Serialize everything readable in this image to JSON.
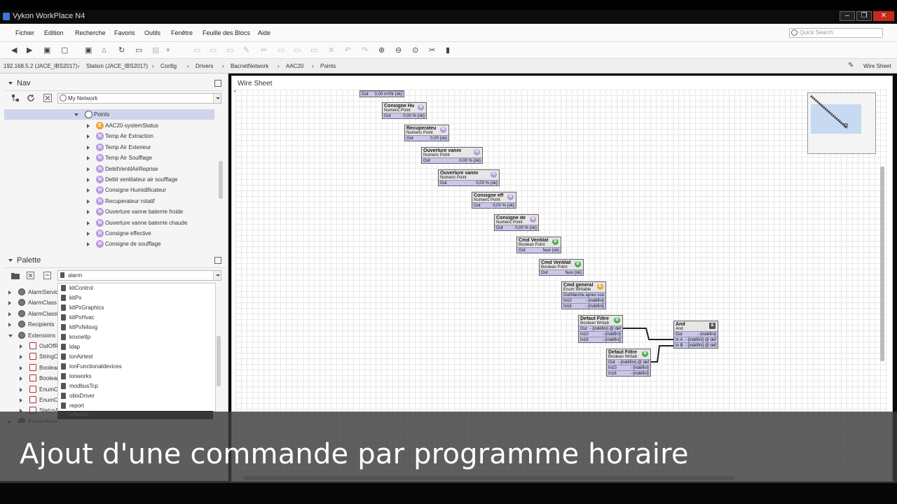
{
  "window": {
    "title": "Vykon WorkPlace N4"
  },
  "menu": [
    "Fichier",
    "Edition",
    "Recherche",
    "Favoris",
    "Outils",
    "Fenêtre",
    "Feuille des Blocs",
    "Aide"
  ],
  "search": {
    "placeholder": "Quick Search"
  },
  "breadcrumb": [
    "192.168.5.2 (JACE_IBS2017)",
    "Station (JACE_IBS2017)",
    "Config",
    "Drivers",
    "BacnetNetwork",
    "AAC20",
    "Points"
  ],
  "view_selector": "Wire Sheet",
  "nav": {
    "title": "Nav",
    "network": "My Network",
    "selected": "Points",
    "items": [
      {
        "label": "AAC20-systemStatus",
        "icon": "E"
      },
      {
        "label": "Temp Air Extraction",
        "icon": "N"
      },
      {
        "label": "Temp Air Exterieur",
        "icon": "N"
      },
      {
        "label": "Temp Air Soufflage",
        "icon": "N"
      },
      {
        "label": "DebitVentilAirReprise",
        "icon": "N"
      },
      {
        "label": "Debit ventilateur air soufflage",
        "icon": "N"
      },
      {
        "label": "Consigne Humidificateur",
        "icon": "N"
      },
      {
        "label": "Recuperateur rotatif",
        "icon": "N"
      },
      {
        "label": "Ouverture vanne baterrie froide",
        "icon": "N"
      },
      {
        "label": "Ouverture vanne baterrie chaude",
        "icon": "N"
      },
      {
        "label": "Consigne effective",
        "icon": "N"
      },
      {
        "label": "Consigne de soufflage",
        "icon": "N"
      }
    ]
  },
  "palette": {
    "title": "Palette",
    "filter": "alarm",
    "modules": [
      "kitControl",
      "kitPx",
      "kitPxGraphics",
      "kitPxHvac",
      "kitPxN4svg",
      "knxnetIp",
      "ldap",
      "lonAirtest",
      "lonFunctionaldevices",
      "lonworks",
      "modbusTcp",
      "obixDriver",
      "report"
    ],
    "drag_label": "schedule",
    "tree": [
      {
        "label": "AlarmService",
        "depth": 1,
        "exp": "r"
      },
      {
        "label": "AlarmClass",
        "depth": 1,
        "exp": "r"
      },
      {
        "label": "AlarmClassFolder",
        "depth": 1,
        "exp": "r"
      },
      {
        "label": "Recipients",
        "depth": 1,
        "exp": "r"
      },
      {
        "label": "Extensions",
        "depth": 1,
        "exp": "d"
      },
      {
        "label": "OutOfRange",
        "depth": 2,
        "exp": "r"
      },
      {
        "label": "StringChange",
        "depth": 2,
        "exp": "r"
      },
      {
        "label": "BooleanChange",
        "depth": 2,
        "exp": "r"
      },
      {
        "label": "BooleanCov",
        "depth": 2,
        "exp": "r"
      },
      {
        "label": "EnumChange",
        "depth": 2,
        "exp": "r"
      },
      {
        "label": "EnumCov",
        "depth": 2,
        "exp": "r"
      },
      {
        "label": "StatusAlarm",
        "depth": 2,
        "exp": "r"
      },
      {
        "label": "PrinterRecipient",
        "depth": 1,
        "exp": "r"
      }
    ]
  },
  "wiresheet": {
    "tab": "Wire Sheet",
    "blocks": [
      {
        "title": "",
        "type": "",
        "badge": "",
        "slots": [
          [
            "Out",
            "0,00 m³/hr {ok}"
          ]
        ]
      },
      {
        "title": "Consigne Hu",
        "type": "Numeric Point",
        "badge": "N",
        "slots": [
          [
            "Out",
            "0,00 % {ok}"
          ]
        ]
      },
      {
        "title": "Recuperateu",
        "type": "Numeric Point",
        "badge": "N",
        "slots": [
          [
            "Out",
            "0,00 {ok}"
          ]
        ]
      },
      {
        "title": "Ouverture vanne ba",
        "type": "Numeric Point",
        "badge": "N",
        "slots": [
          [
            "Out",
            "0,00 % {ok}"
          ]
        ]
      },
      {
        "title": "Ouverture vanne ba",
        "type": "Numeric Point",
        "badge": "N",
        "slots": [
          [
            "Out",
            "0,00 % {ok}"
          ]
        ]
      },
      {
        "title": "Consigne eff",
        "type": "Numeric Point",
        "badge": "N",
        "slots": [
          [
            "Out",
            "0,00 % {ok}"
          ]
        ]
      },
      {
        "title": "Consigne de",
        "type": "Numeric Point",
        "badge": "N",
        "slots": [
          [
            "Out",
            "0,00 % {ok}"
          ]
        ]
      },
      {
        "title": "Cmd Ventilat",
        "type": "Boolean Point",
        "badge": "B",
        "slots": [
          [
            "Out",
            "faux {ok}"
          ]
        ]
      },
      {
        "title": "Cmd Ventilat",
        "type": "Boolean Point",
        "badge": "B",
        "slots": [
          [
            "Out",
            "faux {ok}"
          ]
        ]
      },
      {
        "title": "Cmd general",
        "type": "Enum Writable",
        "badge": "E",
        "slots": [
          [
            "Out",
            "Marche apres cou"
          ],
          [
            "In10",
            "- {indéfini}"
          ],
          [
            "In16",
            "- {indéfini}"
          ]
        ]
      },
      {
        "title": "Defaut Filtre",
        "type": "Boolean Writab",
        "badge": "B",
        "slots": [
          [
            "Out",
            "- {indéfini} @ def"
          ],
          [
            "In10",
            "- {indéfini}"
          ],
          [
            "In16",
            "- {indéfini}"
          ]
        ]
      },
      {
        "title": "Defaut Filtre",
        "type": "Boolean Writab",
        "badge": "B",
        "slots": [
          [
            "Out",
            "- {indéfini} @ def"
          ],
          [
            "In10",
            "- {indéfini}"
          ],
          [
            "In16",
            "- {indéfini}"
          ]
        ]
      },
      {
        "title": "And",
        "type": "And",
        "badge": "&",
        "slots": [
          [
            "Out",
            "- {indéfini}"
          ],
          [
            "In A",
            "- {indéfini} @ def"
          ],
          [
            "In B",
            "- {indéfini} @ def"
          ]
        ]
      }
    ]
  },
  "caption": "Ajout d'une commande par programme horaire",
  "colors": {
    "numeric": "#b99ae0",
    "boolean": "#4caf50",
    "enum": "#f0a63a",
    "slot": "#c9c7ec",
    "selection": "#cfd5ee"
  }
}
